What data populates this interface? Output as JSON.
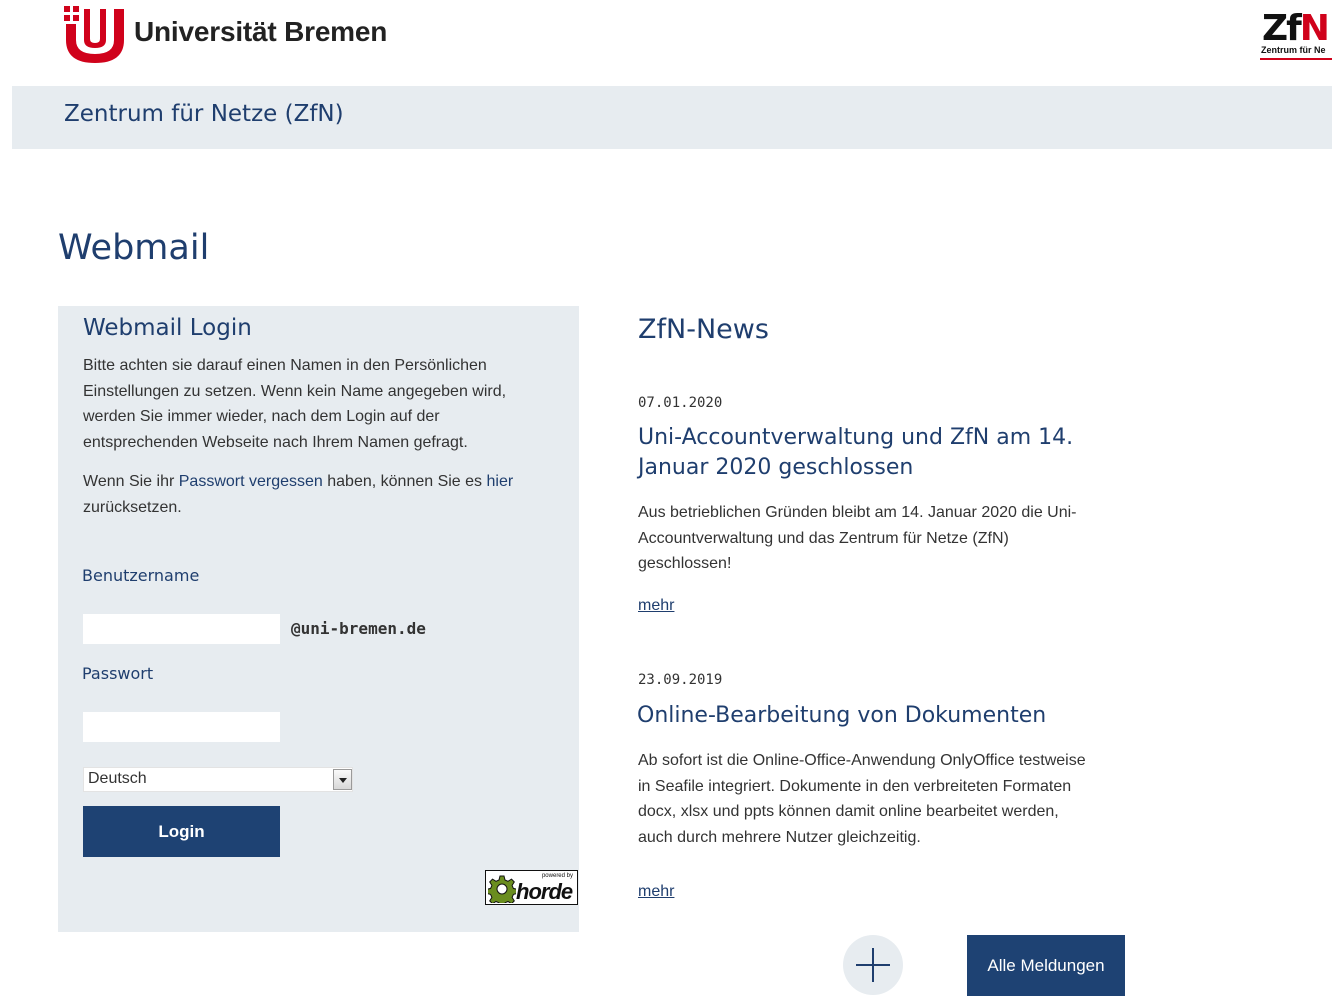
{
  "header": {
    "university_name": "Universität Bremen",
    "zfn_logo_text": "ZfN",
    "zfn_logo_subtext": "Zentrum für Ne"
  },
  "nav": {
    "center_name": "Zentrum für Netze (ZfN)"
  },
  "page": {
    "title": "Webmail"
  },
  "login": {
    "heading": "Webmail Login",
    "notice": "Bitte achten sie darauf einen Namen in den Persönlichen Einstellungen zu setzen. Wenn kein Name angegeben wird, werden Sie immer wieder, nach dem Login auf der entsprechenden Webseite nach Ihrem Namen gefragt.",
    "reset_prefix": "Wenn Sie ihr ",
    "reset_link_forgot": "Passwort vergessen",
    "reset_middle": " haben, können Sie es ",
    "reset_link_here": "hier",
    "reset_suffix": " zurücksetzen.",
    "username_label": "Benutzername",
    "username_value": "",
    "domain_suffix": "@uni-bremen.de",
    "password_label": "Passwort",
    "password_value": "",
    "language_selected": "Deutsch",
    "login_button": "Login",
    "horde_powered_by": "powered by",
    "horde_word": "horde"
  },
  "news": {
    "heading": "ZfN-News",
    "items": [
      {
        "date": "07.01.2020",
        "title": "Uni-Accountverwaltung und ZfN am 14. Januar 2020 geschlossen",
        "body": "Aus betrieblichen Gründen bleibt am 14. Januar 2020 die Uni-Accountverwaltung und das Zentrum für Netze (ZfN) geschlossen!",
        "more": "mehr"
      },
      {
        "date": "23.09.2019",
        "title": "Online-Bearbeitung von Dokumenten",
        "body": "Ab sofort ist die Online-Office-Anwendung OnlyOffice testweise in Seafile integriert. Dokumente in den verbreiteten Formaten docx, xlsx und ppts können damit online bearbeitet werden, auch durch mehrere Nutzer gleichzeitig.",
        "more": "mehr"
      }
    ],
    "all_news_button": "Alle Meldungen"
  },
  "colors": {
    "primary_blue": "#1f3e6e",
    "button_blue": "#1e4273",
    "panel_gray": "#e7ecf0",
    "brand_red": "#d0021b"
  },
  "icons": {
    "uni_logo": "university-bremen-logo",
    "zfn_logo": "zfn-logo",
    "plus": "plus-icon",
    "select_arrow": "chevron-down-icon",
    "horde_gear": "gear-icon"
  }
}
